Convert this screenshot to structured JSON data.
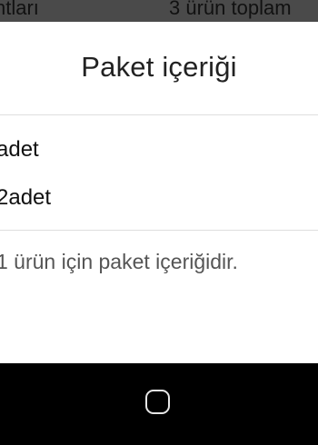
{
  "backdrop": {
    "left_text": "ntları",
    "right_text": "3 ürün toplam"
  },
  "sheet": {
    "title": "Paket içeriği",
    "items": [
      {
        "label": "adet"
      },
      {
        "label": "2adet"
      }
    ],
    "note": "1 ürün için paket içeriğidir."
  },
  "navbar": {
    "home_icon": "home-icon"
  }
}
